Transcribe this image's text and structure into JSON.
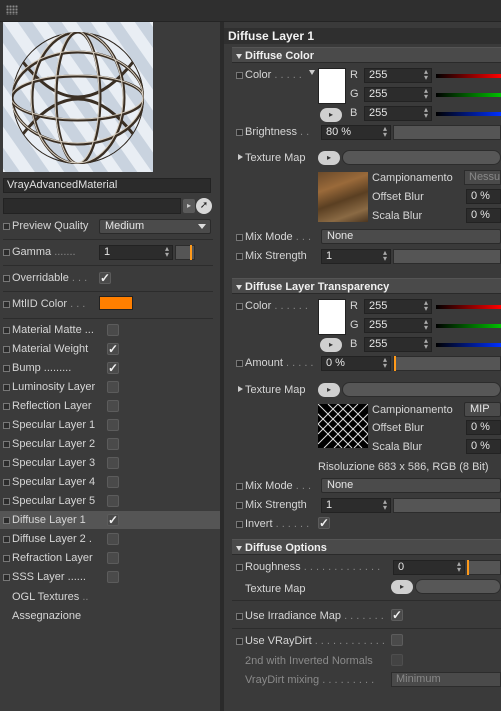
{
  "material": {
    "name": "VrayAdvancedMaterial"
  },
  "left": {
    "preview_quality_label": "Preview Quality",
    "preview_quality_value": "Medium",
    "gamma_label": "Gamma",
    "gamma_value": "1",
    "overridable_label": "Overridable",
    "mtlid_label": "MtlID Color",
    "mtlid_color": "#ff7f00",
    "channels": [
      {
        "label": "Material Matte",
        "dots": "...",
        "checked": false
      },
      {
        "label": "Material Weight",
        "dots": "",
        "checked": true
      },
      {
        "label": "Bump",
        "dots": ".........",
        "checked": true
      },
      {
        "label": "Luminosity Layer",
        "dots": "",
        "checked": false
      },
      {
        "label": "Reflection Layer",
        "dots": "",
        "checked": false
      },
      {
        "label": "Specular Layer 1",
        "dots": "",
        "checked": false
      },
      {
        "label": "Specular Layer 2",
        "dots": "",
        "checked": false
      },
      {
        "label": "Specular Layer 3",
        "dots": "",
        "checked": false
      },
      {
        "label": "Specular Layer 4",
        "dots": "",
        "checked": false
      },
      {
        "label": "Specular Layer 5",
        "dots": "",
        "checked": false
      },
      {
        "label": "Diffuse Layer 1",
        "dots": "",
        "checked": true,
        "selected": true
      },
      {
        "label": "Diffuse Layer 2",
        "dots": ".",
        "checked": false
      },
      {
        "label": "Refraction Layer",
        "dots": "",
        "checked": false
      },
      {
        "label": "SSS Layer",
        "dots": "......",
        "checked": false
      }
    ],
    "ogl_textures": "OGL Textures",
    "ogl_dots": "..",
    "assegnazione": "Assegnazione"
  },
  "right": {
    "title": "Diffuse Layer 1",
    "diffuse_color": {
      "header": "Diffuse Color",
      "color_label": "Color",
      "r_label": "R",
      "r": "255",
      "g_label": "G",
      "g": "255",
      "b_label": "B",
      "b": "255",
      "brightness_label": "Brightness",
      "brightness": "80 %",
      "brightness_level": 0.8,
      "texture_map_label": "Texture Map",
      "campionamento_label": "Campionamento",
      "campionamento_value": "Nessu",
      "offset_blur_label": "Offset Blur",
      "offset_blur": "0 %",
      "scala_blur_label": "Scala Blur",
      "scala_blur": "0 %",
      "mix_mode_label": "Mix Mode",
      "mix_mode": "None",
      "mix_strength_label": "Mix Strength",
      "mix_strength": "1"
    },
    "transparency": {
      "header": "Diffuse Layer Transparency",
      "color_label": "Color",
      "r_label": "R",
      "r": "255",
      "g_label": "G",
      "g": "255",
      "b_label": "B",
      "b": "255",
      "amount_label": "Amount",
      "amount": "0 %",
      "texture_map_label": "Texture Map",
      "campionamento_label": "Campionamento",
      "campionamento_value": "MIP",
      "offset_blur_label": "Offset Blur",
      "offset_blur": "0 %",
      "scala_blur_label": "Scala Blur",
      "scala_blur": "0 %",
      "resolution": "Risoluzione 683 x 586, RGB (8 Bit)",
      "mix_mode_label": "Mix Mode",
      "mix_mode": "None",
      "mix_strength_label": "Mix Strength",
      "mix_strength": "1",
      "invert_label": "Invert"
    },
    "options": {
      "header": "Diffuse Options",
      "roughness_label": "Roughness",
      "roughness": "0",
      "texture_map_label": "Texture Map",
      "irradiance_label": "Use Irradiance Map",
      "vraydirt_label": "Use VRayDirt",
      "inverted_label": "2nd with Inverted Normals",
      "mixing_label": "VrayDirt mixing",
      "mixing_value": "Minimum"
    }
  }
}
